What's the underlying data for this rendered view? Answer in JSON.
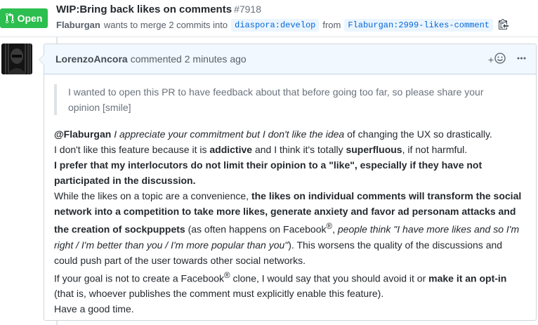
{
  "pr": {
    "state": "Open",
    "title": "WIP:Bring back likes on comments",
    "number": "#7918",
    "author": "Flaburgan",
    "merge_text": "wants to merge 2 commits into",
    "base_branch": "diaspora:develop",
    "from_text": "from",
    "head_branch": "Flaburgan:2999-likes-comment"
  },
  "comment": {
    "author": "LorenzoAncora",
    "action": "commented",
    "time": "2 minutes ago",
    "add_reaction": "+",
    "quote": "I wanted to open this PR to have feedback about that before going too far, so please share your opinion [smile]",
    "p1": {
      "mention": "@Flaburgan",
      "em1": "I appreciate your commitment but I don't like the idea",
      "t1": " of changing the UX so drastically."
    },
    "p2": {
      "t1": "I don't like this feature because it is ",
      "b1": "addictive",
      "t2": " and I think it's totally ",
      "b2": "superfluous",
      "t3": ", if not harmful."
    },
    "p3": {
      "b1": "I prefer that my interlocutors do not limit their opinion to a \"like\", especially if they have not participated in the discussion."
    },
    "p4": {
      "t1": "While the likes on a topic are a convenience, ",
      "b1": "the likes on individual comments will transform the social network into a competition to take more likes, generate anxiety and favor ad personam attacks and the creation of sockpuppets",
      "t2": " (as often happens on Facebook",
      "reg": "®",
      "t3": ", ",
      "em1": "people think \"I have more likes and so I'm right / I'm better than you / I'm more popular than you\"",
      "t4": "). This worsens the quality of the discussions and could push part of the user towards other social networks."
    },
    "p5": {
      "t1": "If your goal is not to create a Facebook",
      "reg": "®",
      "t2": " clone, I would say that you should avoid it or ",
      "b1": "make it an opt-in",
      "t3": " (that is, whoever publishes the comment must explicitly enable this feature)."
    },
    "p6": "Have a good time."
  },
  "colors": {
    "open_green": "#2cbe4e",
    "branch_blue": "#0366d6",
    "header_bg": "#f1f8ff"
  },
  "icons": [
    "git-pull-request-icon",
    "clippy-icon",
    "smiley-icon",
    "kebab-horizontal-icon"
  ]
}
